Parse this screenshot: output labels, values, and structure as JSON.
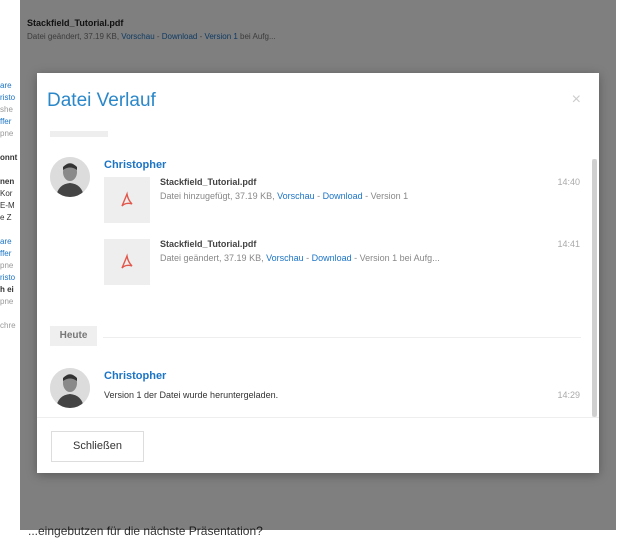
{
  "background": {
    "file_name": "Stackfield_Tutorial.pdf",
    "meta_prefix": "Datei geändert, 37.19 KB, ",
    "link_preview": "Vorschau",
    "sep1": " - ",
    "link_download": "Download",
    "sep2": " - ",
    "link_version": "Version 1",
    "meta_suffix": " bei Aufg...",
    "left_fragments": [
      "are",
      "risto",
      "she",
      "ffer",
      "pne",
      "",
      "onnt",
      "",
      "nen",
      "Kor",
      "E-M",
      "e Z",
      "",
      "are",
      "ffer",
      "pne",
      "risto",
      "h ei",
      "pne",
      "",
      "chre"
    ],
    "bottom_text": "...eingebutzen für die nächste Präsentation?"
  },
  "modal": {
    "title": "Datei Verlauf",
    "close_glyph": "×",
    "groups": [
      {
        "user": "Christopher",
        "files": [
          {
            "name": "Stackfield_Tutorial.pdf",
            "meta_prefix": "Datei hinzugefügt, 37.19 KB, ",
            "preview": "Vorschau",
            "sep1": " - ",
            "download": "Download",
            "meta_suffix": " - Version 1",
            "time": "14:40"
          },
          {
            "name": "Stackfield_Tutorial.pdf",
            "meta_prefix": "Datei geändert, 37.19 KB, ",
            "preview": "Vorschau",
            "sep1": " - ",
            "download": "Download",
            "meta_suffix": " - Version 1 bei Aufg...",
            "time": "14:41"
          }
        ]
      }
    ],
    "day_label": "Heute",
    "today_group": {
      "user": "Christopher",
      "message": "Version 1 der Datei wurde heruntergeladen.",
      "time": "14:29"
    },
    "footer_button": "Schließen"
  },
  "colors": {
    "accent": "#2a87c9",
    "link": "#1b74c6",
    "pdf_red": "#e2574c"
  },
  "icons": [
    "close-icon",
    "pdf-icon",
    "avatar"
  ]
}
